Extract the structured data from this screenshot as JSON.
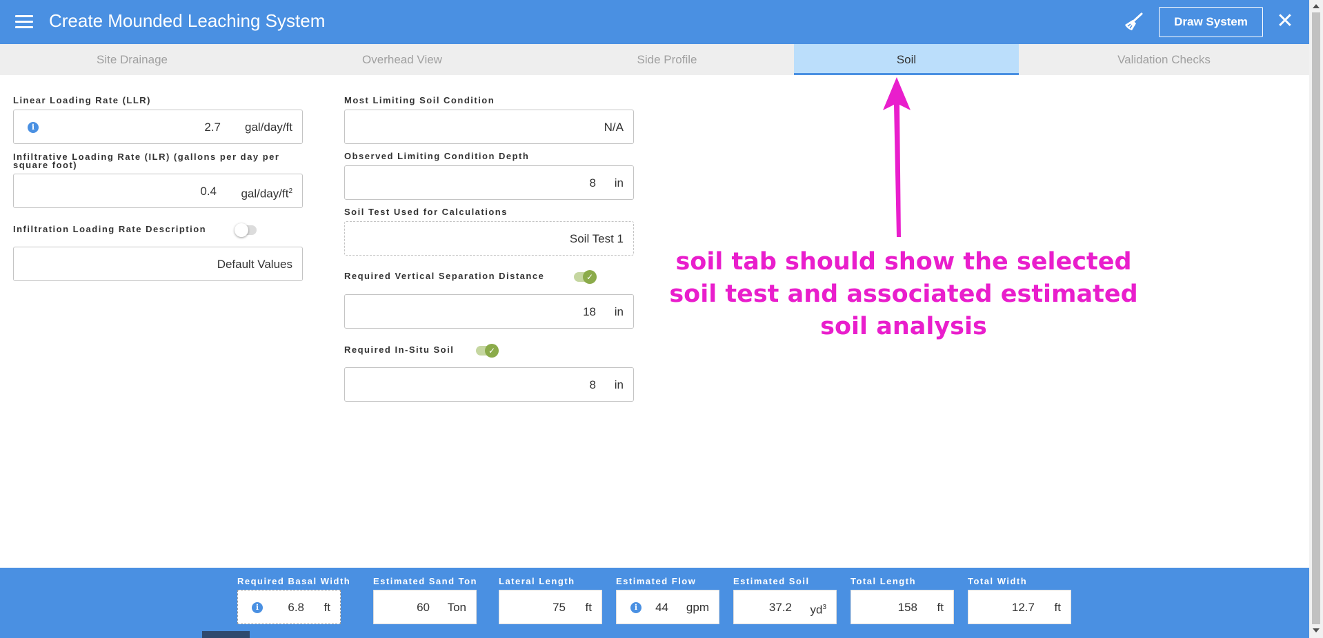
{
  "header": {
    "title": "Create Mounded Leaching System",
    "draw_button": "Draw System",
    "close_glyph": "✕",
    "icons": [
      "menu-icon",
      "broom-icon",
      "close-icon"
    ],
    "bar_color": "#4a90e2"
  },
  "tabs": [
    {
      "label": "Site Drainage",
      "active": false
    },
    {
      "label": "Overhead View",
      "active": false
    },
    {
      "label": "Side Profile",
      "active": false
    },
    {
      "label": "Soil",
      "active": true
    },
    {
      "label": "Validation Checks",
      "active": false
    }
  ],
  "left_column": {
    "llr": {
      "label": "Linear Loading Rate (LLR)",
      "value": "2.7",
      "unit": "gal/day/ft"
    },
    "ilr": {
      "label": "Infiltrative Loading Rate (ILR) (gallons per day per square foot)",
      "value": "0.4",
      "unit": "gal/day/ft",
      "unit_sup": "2"
    },
    "ilr_description": {
      "label": "Infiltration Loading Rate Description",
      "toggle_on": false,
      "value": "Default Values"
    }
  },
  "middle_column": {
    "limiting_condition": {
      "label": "Most Limiting Soil Condition",
      "value": "N/A"
    },
    "observed_depth": {
      "label": "Observed Limiting Condition Depth",
      "value": "8",
      "unit": "in"
    },
    "soil_test": {
      "label": "Soil Test Used for Calculations",
      "value": "Soil Test 1"
    },
    "vertical_separation": {
      "label": "Required Vertical Separation Distance",
      "toggle_on": true,
      "value": "18",
      "unit": "in"
    },
    "insitu_soil": {
      "label": "Required In-Situ Soil",
      "toggle_on": true,
      "value": "8",
      "unit": "in"
    }
  },
  "annotation": {
    "text_line1": "soil tab should show the selected",
    "text_line2": "soil test and associated estimated",
    "text_line3": "soil analysis",
    "color": "#e91ecc"
  },
  "summary": {
    "basal_width": {
      "label": "Required Basal Width",
      "value": "6.8",
      "unit": "ft"
    },
    "sand_ton": {
      "label": "Estimated Sand Ton",
      "value": "60",
      "unit": "Ton"
    },
    "lateral_length": {
      "label": "Lateral Length",
      "value": "75",
      "unit": "ft"
    },
    "flow": {
      "label": "Estimated Flow",
      "value": "44",
      "unit": "gpm"
    },
    "soil": {
      "label": "Estimated Soil",
      "value": "37.2",
      "unit": "yd",
      "unit_sup": "3"
    },
    "total_length": {
      "label": "Total Length",
      "value": "158",
      "unit": "ft"
    },
    "total_width": {
      "label": "Total Width",
      "value": "12.7",
      "unit": "ft"
    }
  }
}
